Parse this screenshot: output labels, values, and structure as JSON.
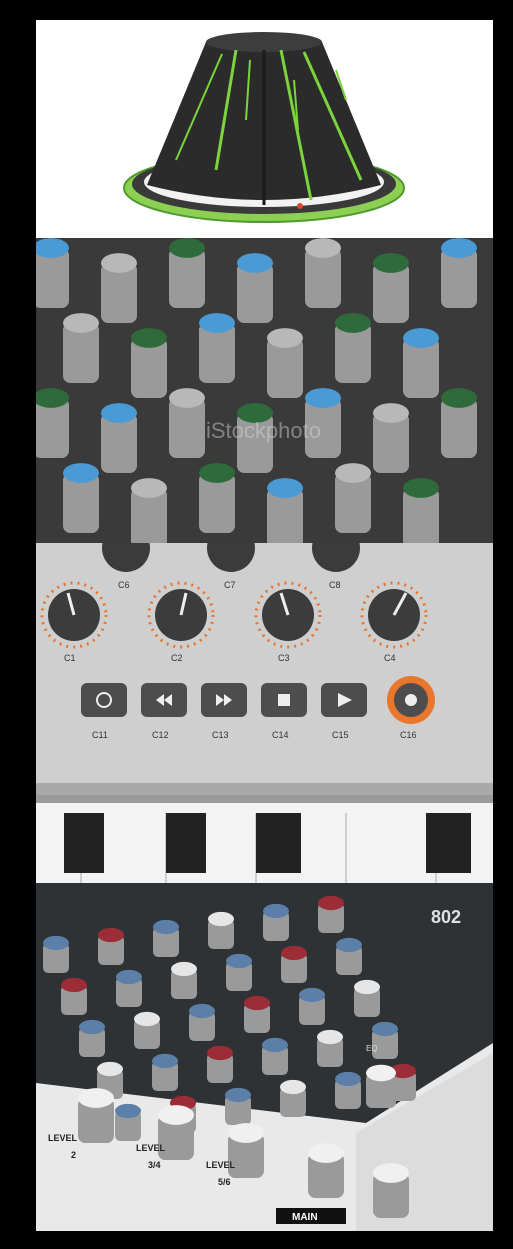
{
  "collage": {
    "panels": [
      {
        "id": "panel-1",
        "subject": "3d-knob-render"
      },
      {
        "id": "panel-2",
        "subject": "mixing-desk-knobs-closeup"
      },
      {
        "id": "panel-3",
        "subject": "midi-controller-knobs-and-buttons"
      },
      {
        "id": "panel-4",
        "subject": "compact-mixer-top-view"
      }
    ]
  },
  "panel2": {
    "watermark": "iStockphoto"
  },
  "panel3": {
    "top_knob_labels": [
      "C6",
      "C7",
      "C8"
    ],
    "knob_labels": [
      "C1",
      "C2",
      "C3",
      "C4"
    ],
    "button_labels": [
      "C11",
      "C12",
      "C13",
      "C14",
      "C15",
      "C16"
    ],
    "button_icons": [
      "loop-icon",
      "rewind-icon",
      "fast-forward-icon",
      "stop-icon",
      "play-icon",
      "record-icon"
    ],
    "accent": "#e8762c"
  },
  "panel4": {
    "level_label": "LEVEL",
    "channel_labels": [
      "2",
      "3/4",
      "5/6"
    ],
    "brand_fragment": "802",
    "section_label": "MAIN",
    "eq_label": "EQ"
  }
}
